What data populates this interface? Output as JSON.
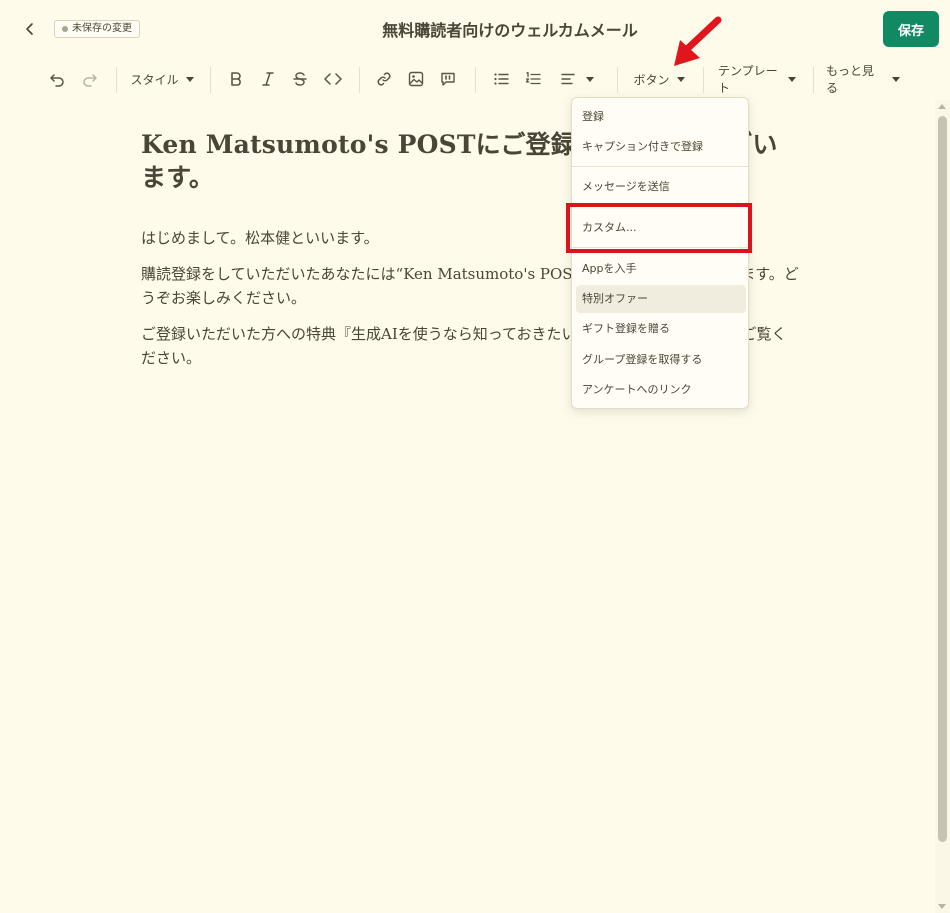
{
  "header": {
    "title": "無料購読者向けのウェルカムメール",
    "unsaved_label": "未保存の変更",
    "save_label": "保存"
  },
  "toolbar": {
    "style_label": "スタイル",
    "button_label": "ボタン",
    "template_label": "テンプレート",
    "more_label": "もっと見る",
    "icons": [
      "undo-icon",
      "redo-icon",
      "bold-icon",
      "italic-icon",
      "strikethrough-icon",
      "code-icon",
      "link-icon",
      "image-icon",
      "quote-icon",
      "bullet-list-icon",
      "numbered-list-icon",
      "align-icon"
    ]
  },
  "editor": {
    "heading": "Ken Matsumoto's POSTにご登録ありがとうございます。",
    "paragraphs": [
      "はじめまして。松本健といいます。",
      "購読登録をしていただいたあなたには“Ken Matsumoto's POST”の記事がメールで届きます。どうぞお楽しみください。",
      "ご登録いただいた方への特典『生成AIを使うなら知っておきたいこと』は下のボタンからご覧ください。"
    ]
  },
  "dropdown": {
    "items": [
      {
        "label": "登録"
      },
      {
        "label": "キャプション付きで登録"
      },
      {
        "label": "メッセージを送信"
      },
      {
        "label": "カスタム..."
      },
      {
        "label": "Appを入手"
      },
      {
        "label": "特別オファー"
      },
      {
        "label": "ギフト登録を贈る"
      },
      {
        "label": "グループ登録を取得する"
      },
      {
        "label": "アンケートへのリンク"
      }
    ],
    "highlighted_item": "特別オファー"
  },
  "colors": {
    "background": "#fffbeb",
    "accent": "#0f8a62",
    "text": "#4a4536",
    "annotation": "#d9151b"
  }
}
